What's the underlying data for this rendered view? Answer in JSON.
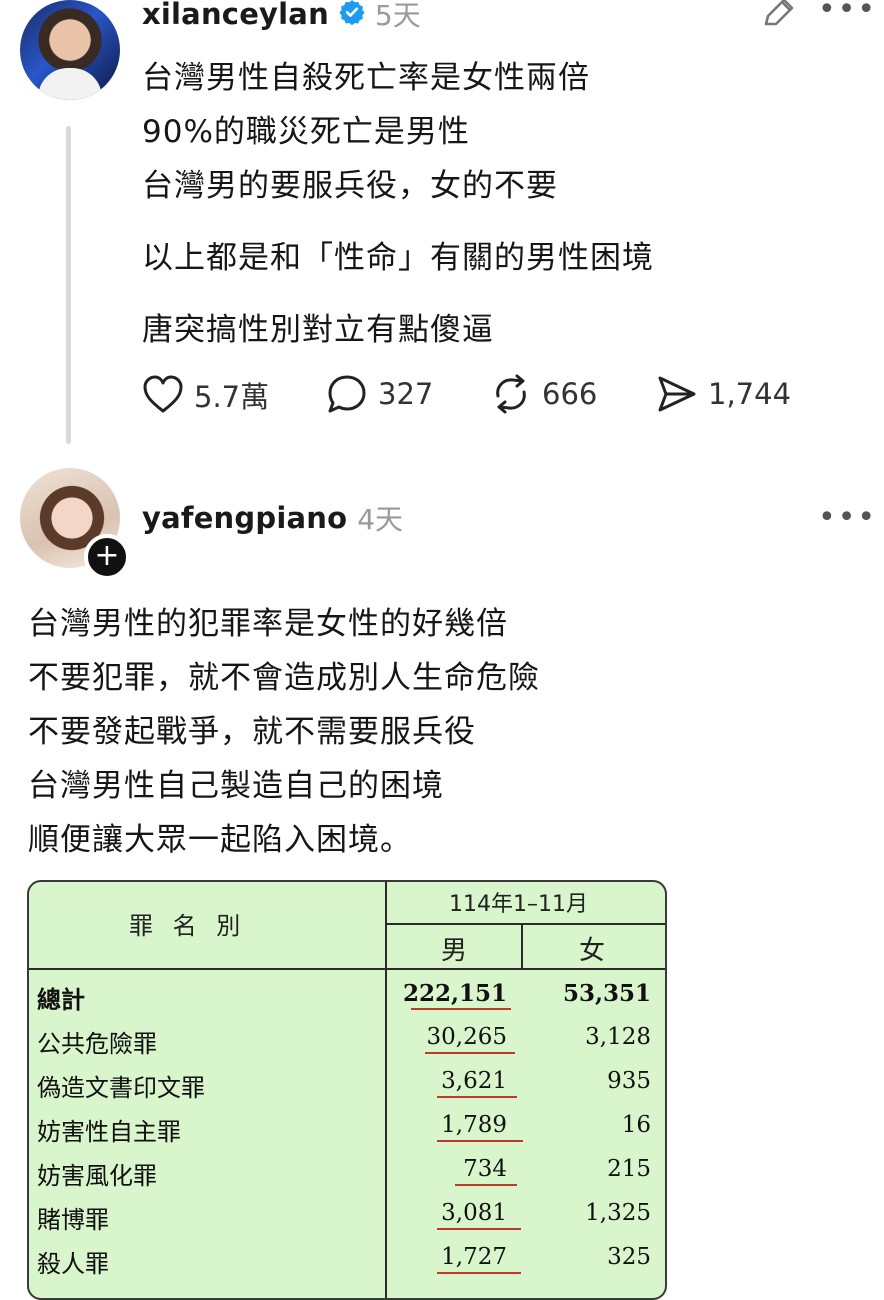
{
  "post": {
    "username": "xilanceylan",
    "timestamp": "5天",
    "lines": [
      "台灣男性自殺死亡率是女性兩倍",
      "90%的職災死亡是男性",
      "台灣男的要服兵役，女的不要",
      "以上都是和「性命」有關的男性困境",
      "唐突搞性別對立有點傻逼"
    ],
    "actions": {
      "likes": "5.7萬",
      "comments": "327",
      "reposts": "666",
      "shares": "1,744"
    }
  },
  "reply": {
    "username": "yafengpiano",
    "timestamp": "4天",
    "follow_badge": "+",
    "lines": [
      "台灣男性的犯罪率是女性的好幾倍",
      "不要犯罪，就不會造成別人生命危險",
      "不要發起戰爭，就不需要服兵役",
      "台灣男性自己製造自己的困境",
      "順便讓大眾一起陷入困境。"
    ]
  },
  "table": {
    "header_label": "罪 名 別",
    "period": "114年1–11月",
    "col_male": "男",
    "col_female": "女",
    "rows": [
      {
        "name": "總計",
        "male": "222,151",
        "female": "53,351"
      },
      {
        "name": "公共危險罪",
        "male": "30,265",
        "female": "3,128"
      },
      {
        "name": "偽造文書印文罪",
        "male": "3,621",
        "female": "935"
      },
      {
        "name": "妨害性自主罪",
        "male": "1,789",
        "female": "16"
      },
      {
        "name": "妨害風化罪",
        "male": "734",
        "female": "215"
      },
      {
        "name": "賭博罪",
        "male": "3,081",
        "female": "1,325"
      },
      {
        "name": "殺人罪",
        "male": "1,727",
        "female": "325"
      }
    ],
    "colors": {
      "background": "#d8f5cc",
      "underline": "#c0392b"
    }
  },
  "icons": [
    "verified-icon",
    "edit-icon",
    "more-icon",
    "heart-icon",
    "comment-icon",
    "repost-icon",
    "share-icon",
    "follow-icon"
  ]
}
